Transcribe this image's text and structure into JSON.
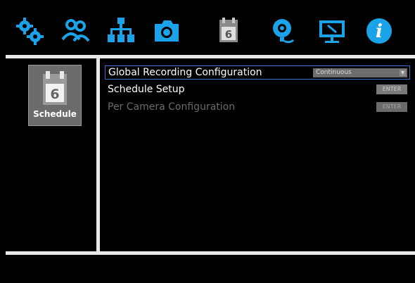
{
  "toolbar": {
    "icons": [
      {
        "name": "gear-icon"
      },
      {
        "name": "users-icon"
      },
      {
        "name": "network-icon"
      },
      {
        "name": "camera-icon"
      },
      {
        "name": "schedule-calendar-icon",
        "text": "6"
      },
      {
        "name": "alarm-bell-icon"
      },
      {
        "name": "display-icon"
      },
      {
        "name": "info-icon",
        "text": "i"
      }
    ],
    "accent": "#1aa3e8",
    "active_icon_color": "#8a8a8a"
  },
  "sidebar": {
    "item": {
      "label": "Schedule",
      "icon": "calendar-icon",
      "number": "6"
    }
  },
  "main": {
    "rows": [
      {
        "label": "Global Recording Configuration",
        "control": "select",
        "value": "Continuous",
        "selected": true
      },
      {
        "label": "Schedule Setup",
        "control": "button",
        "button_label": "ENTER"
      },
      {
        "label": "Per Camera Configuration",
        "control": "button",
        "button_label": "ENTER",
        "disabled": true
      }
    ]
  },
  "colors": {
    "background": "#000000",
    "divider": "#e9e9e9",
    "selection": "#3a6fd0"
  }
}
